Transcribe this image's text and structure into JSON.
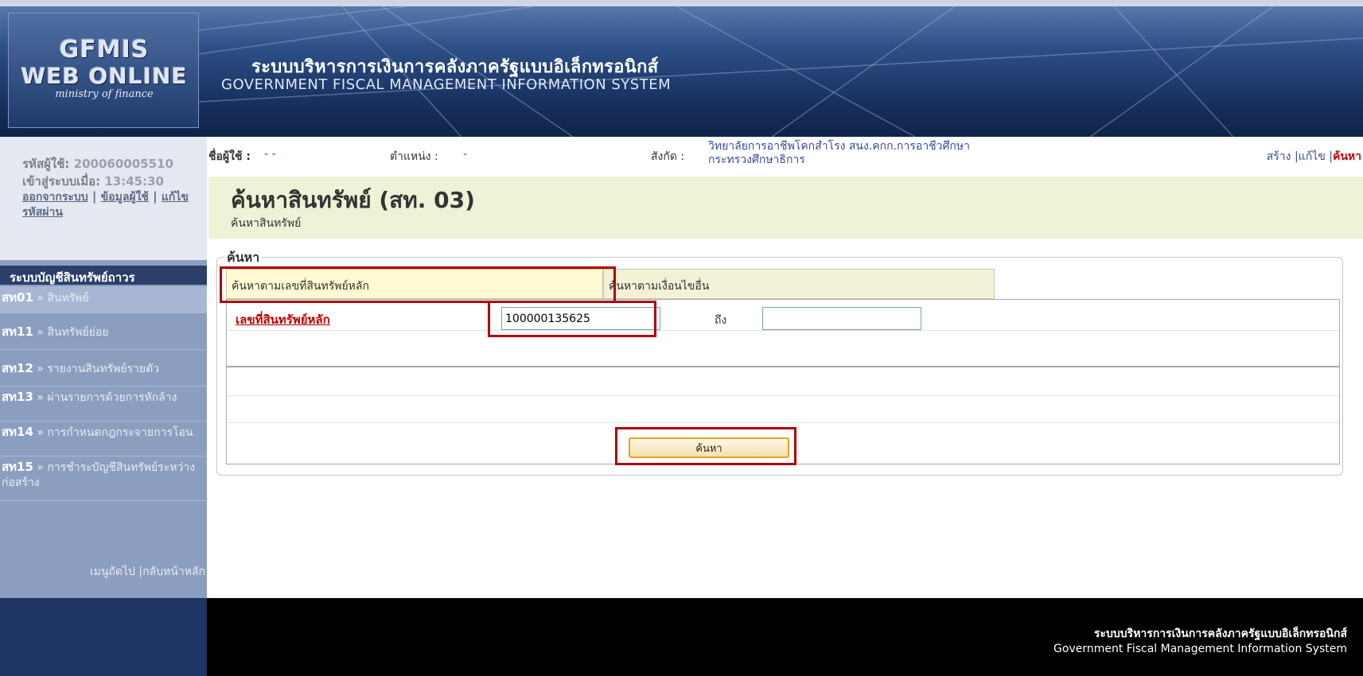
{
  "header": {
    "logo_line1": "GFMIS",
    "logo_line2": "WEB ONLINE",
    "logo_line3": "ministry of finance",
    "title_th": "ระบบบริหารการเงินการคลังภาครัฐแบบอิเล็กทรอนิกส์",
    "title_en": "GOVERNMENT FISCAL MANAGEMENT INFORMATION SYSTEM"
  },
  "user_panel": {
    "user_id_label": "รหัสผู้ใช้:",
    "user_id": "200060005510",
    "login_label": "เข้าสู่ระบบเมื่อ:",
    "login_time": "13:45:30",
    "logout": "ออกจากระบบ",
    "user_info": "ข้อมูลผู้ใช้",
    "change_password": "แก้ไขรหัสผ่าน"
  },
  "menu": {
    "title": "ระบบบัญชีสินทรัพย์ถาวร",
    "items": [
      {
        "code": "สท01",
        "label": "สินทรัพย์"
      },
      {
        "code": "สท11",
        "label": "สินทรัพย์ย่อย"
      },
      {
        "code": "สท12",
        "label": "รายงานสินทรัพย์รายตัว"
      },
      {
        "code": "สท13",
        "label": "ผ่านรายการด้วยการหักล้าง"
      },
      {
        "code": "สท14",
        "label": "การกำหนดกฎกระจายการโอน"
      },
      {
        "code": "สท15",
        "label": "การชำระบัญชีสินทรัพย์ระหว่างก่อสร้าง"
      }
    ],
    "next_menu": "เมนูถัดไป",
    "home": "กลับหน้าหลัก"
  },
  "info_bar": {
    "user_label": "ชื่อผู้ใช้ :",
    "user_value": "- -",
    "position_label": "ตำแหน่ง :",
    "position_value": "-",
    "org_label": "สังกัด :",
    "org_value": "วิทยาลัยการอาชีพโคกสำโรง สนง.คกก.การอาชีวศึกษา กระทรวงศึกษาธิการ",
    "actions": {
      "create": "สร้าง",
      "edit": "แก้ไข",
      "search": "ค้นหา"
    }
  },
  "page": {
    "title": "ค้นหาสินทรัพย์ (สท. 03)",
    "subtitle": "ค้นหาสินทรัพย์"
  },
  "search": {
    "legend": "ค้นหา",
    "tab_asset_no": "ค้นหาตามเลขที่สินทรัพย์หลัก",
    "tab_other": "ค้นหาตามเงื่อนไขอื่น",
    "asset_no_label": "เลขที่สินทรัพย์หลัก",
    "asset_from": "100000135625",
    "to_label": "ถึง",
    "asset_to": "",
    "button": "ค้นหา"
  },
  "footer": {
    "th": "ระบบบริหารการเงินการคลังภาครัฐแบบอิเล็กทรอนิกส์",
    "en": "Government Fiscal Management Information System"
  },
  "colors": {
    "header": "#17305f",
    "sidebar": "#8c9ec0",
    "title_band": "#eef2d6",
    "highlight": "#b30000",
    "link_red": "#c00000"
  }
}
